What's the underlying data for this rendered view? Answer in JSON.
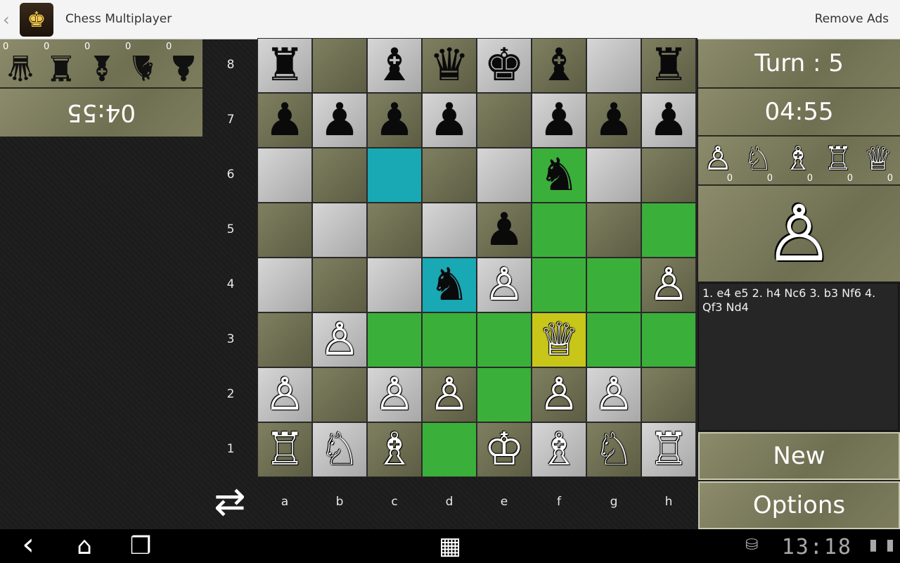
{
  "actionbar": {
    "back_icon": "‹",
    "app_icon": "♚",
    "title": "Chess Multiplayer",
    "remove_ads": "Remove Ads"
  },
  "opponent": {
    "captured": [
      {
        "piece": "♛",
        "count": "0"
      },
      {
        "piece": "♜",
        "count": "0"
      },
      {
        "piece": "♝",
        "count": "0"
      },
      {
        "piece": "♞",
        "count": "0"
      },
      {
        "piece": "♟",
        "count": "0"
      }
    ],
    "timer": "04:55"
  },
  "turn_label": "Turn : 5",
  "player": {
    "timer": "04:55",
    "captured": [
      {
        "piece": "♙",
        "count": "0"
      },
      {
        "piece": "♘",
        "count": "0"
      },
      {
        "piece": "♗",
        "count": "0"
      },
      {
        "piece": "♖",
        "count": "0"
      },
      {
        "piece": "♕",
        "count": "0"
      }
    ],
    "selected_piece": "♙"
  },
  "move_log": "1. e4 e5 2. h4 Nc6 3. b3 Nf6 4. Qf3 Nd4",
  "buttons": {
    "new": "New",
    "options": "Options"
  },
  "ranks": [
    "8",
    "7",
    "6",
    "5",
    "4",
    "3",
    "2",
    "1"
  ],
  "files": [
    "a",
    "b",
    "c",
    "d",
    "e",
    "f",
    "g",
    "h"
  ],
  "board": [
    [
      "♜",
      "",
      "♝",
      "♛",
      "♚",
      "♝",
      "",
      "♜"
    ],
    [
      "♟",
      "♟",
      "♟",
      "♟",
      "",
      "♟",
      "♟",
      "♟"
    ],
    [
      "",
      "",
      "",
      "",
      "",
      "♞",
      "",
      ""
    ],
    [
      "",
      "",
      "",
      "",
      "♟",
      "",
      "",
      ""
    ],
    [
      "",
      "",
      "",
      "♞",
      "♙",
      "",
      "",
      "♙"
    ],
    [
      "",
      "♙",
      "",
      "",
      "",
      "♕",
      "",
      ""
    ],
    [
      "♙",
      "",
      "♙",
      "♙",
      "",
      "♙",
      "♙",
      ""
    ],
    [
      "♖",
      "♘",
      "♗",
      "",
      "♔",
      "♗",
      "♘",
      "♖"
    ]
  ],
  "highlights": {
    "move": [
      "f6",
      "f5",
      "h5",
      "f4",
      "g4",
      "c3",
      "d3",
      "e3",
      "g3",
      "h3",
      "e2",
      "d1"
    ],
    "cyan": [
      "c6",
      "d4"
    ],
    "yellow": [
      "f3"
    ]
  },
  "colors": {
    "move": "#3ab03a",
    "cyan": "#18a9b5",
    "yellow": "#c9c61a",
    "panel": "#7d7d5e"
  },
  "navbar": {
    "back_icon": "‹",
    "home_icon": "⌂",
    "recents_icon": "❐",
    "apps_icon": "▦",
    "bag_icon": "⛁",
    "clock": "13:18",
    "wifi_icon": "▮",
    "battery_icon": "▮"
  }
}
